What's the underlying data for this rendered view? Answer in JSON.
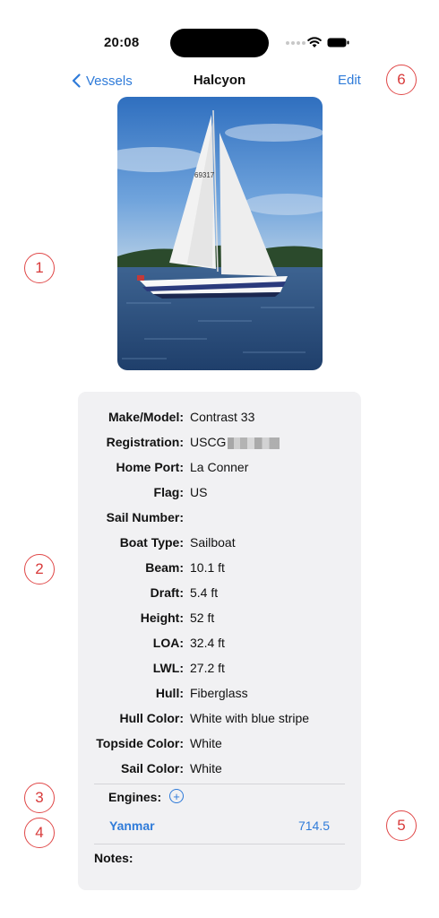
{
  "status_bar": {
    "time": "20:08"
  },
  "nav": {
    "back_label": "Vessels",
    "title": "Halcyon",
    "edit_label": "Edit"
  },
  "photo": {
    "sail_number_text": "69317"
  },
  "details": [
    {
      "label": "Make/Model:",
      "value": "Contrast 33"
    },
    {
      "label": "Registration:",
      "value": "USCG"
    },
    {
      "label": "Home Port:",
      "value": "La Conner"
    },
    {
      "label": "Flag:",
      "value": "US"
    },
    {
      "label": "Sail Number:",
      "value": ""
    },
    {
      "label": "Boat Type:",
      "value": "Sailboat"
    },
    {
      "label": "Beam:",
      "value": "10.1 ft"
    },
    {
      "label": "Draft:",
      "value": "5.4 ft"
    },
    {
      "label": "Height:",
      "value": "52 ft"
    },
    {
      "label": "LOA:",
      "value": "32.4 ft"
    },
    {
      "label": "LWL:",
      "value": "27.2 ft"
    },
    {
      "label": "Hull:",
      "value": "Fiberglass"
    },
    {
      "label": "Hull Color:",
      "value": "White with blue stripe"
    },
    {
      "label": "Topside Color:",
      "value": "White"
    },
    {
      "label": "Sail Color:",
      "value": "White"
    }
  ],
  "engines": {
    "label": "Engines:",
    "add_symbol": "+",
    "items": [
      {
        "name": "Yanmar",
        "hours": "714.5"
      }
    ]
  },
  "notes": {
    "label": "Notes:"
  },
  "callouts": [
    "1",
    "2",
    "3",
    "4",
    "5",
    "6"
  ],
  "colors": {
    "accent": "#2f7bd9",
    "callout": "#e04848",
    "card_bg": "#f1f1f3"
  }
}
